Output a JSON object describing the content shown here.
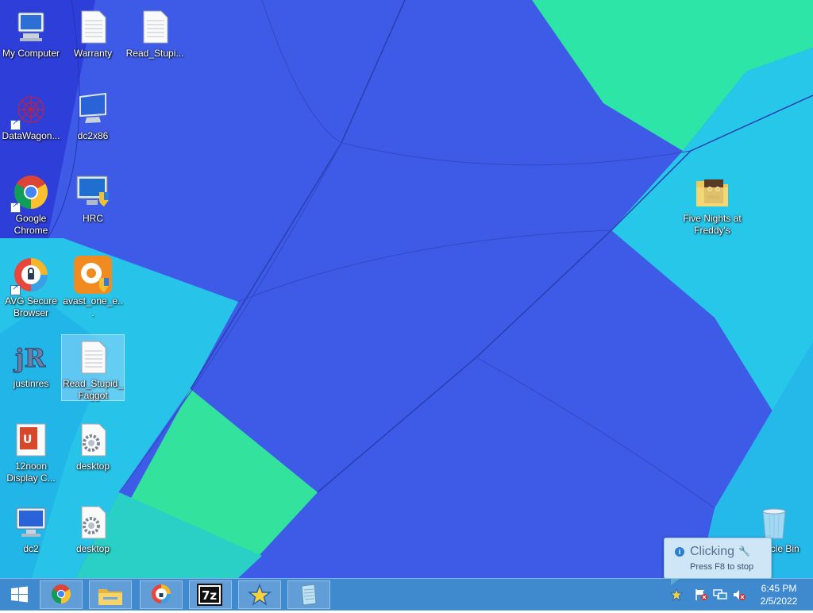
{
  "desktop": {
    "icons": [
      {
        "label": "My Computer",
        "icon": "computer-icon"
      },
      {
        "label": "Warranty",
        "icon": "text-document-icon"
      },
      {
        "label": "Read_Stupi...",
        "icon": "text-document-icon"
      },
      {
        "label": "DataWagon...",
        "icon": "datawagon-icon"
      },
      {
        "label": "dc2x86",
        "icon": "monitor-icon"
      },
      {
        "label": "Google Chrome",
        "icon": "chrome-icon"
      },
      {
        "label": "HRC",
        "icon": "hrc-shield-monitor-icon"
      },
      {
        "label": "AVG Secure Browser",
        "icon": "avg-browser-icon"
      },
      {
        "label": "avast_one_e...",
        "icon": "avast-installer-icon"
      },
      {
        "label": "justinres",
        "icon": "jr-logo-icon"
      },
      {
        "label": "Read_Stupid_ Faggot",
        "icon": "text-document-icon"
      },
      {
        "label": "12noon Display C...",
        "icon": "12noon-display-icon"
      },
      {
        "label": "desktop",
        "icon": "settings-file-icon"
      },
      {
        "label": "dc2",
        "icon": "monitor-icon"
      },
      {
        "label": "desktop",
        "icon": "settings-file-icon"
      },
      {
        "label": "Five Nights at Freddy's",
        "icon": "fnaf-folder-icon"
      },
      {
        "label": "Recycle Bin",
        "icon": "recycle-bin-icon"
      }
    ]
  },
  "taskbar": {
    "start": "windows-start-icon",
    "pinned": [
      "chrome-icon",
      "file-explorer-icon",
      "avg-browser-icon",
      "7zip-icon",
      "star-app-icon",
      "notepad-icon"
    ],
    "tray": [
      "star-tray-icon",
      "action-center-flag-icon",
      "network-icon",
      "volume-muted-icon"
    ]
  },
  "clock": {
    "time": "6:45 PM",
    "date": "2/5/2022"
  },
  "balloon": {
    "title": "Clicking",
    "subtitle": "Press F8 to stop"
  },
  "colors": {
    "taskbar": "#4096c8",
    "balloon": "#cfe6f7"
  }
}
